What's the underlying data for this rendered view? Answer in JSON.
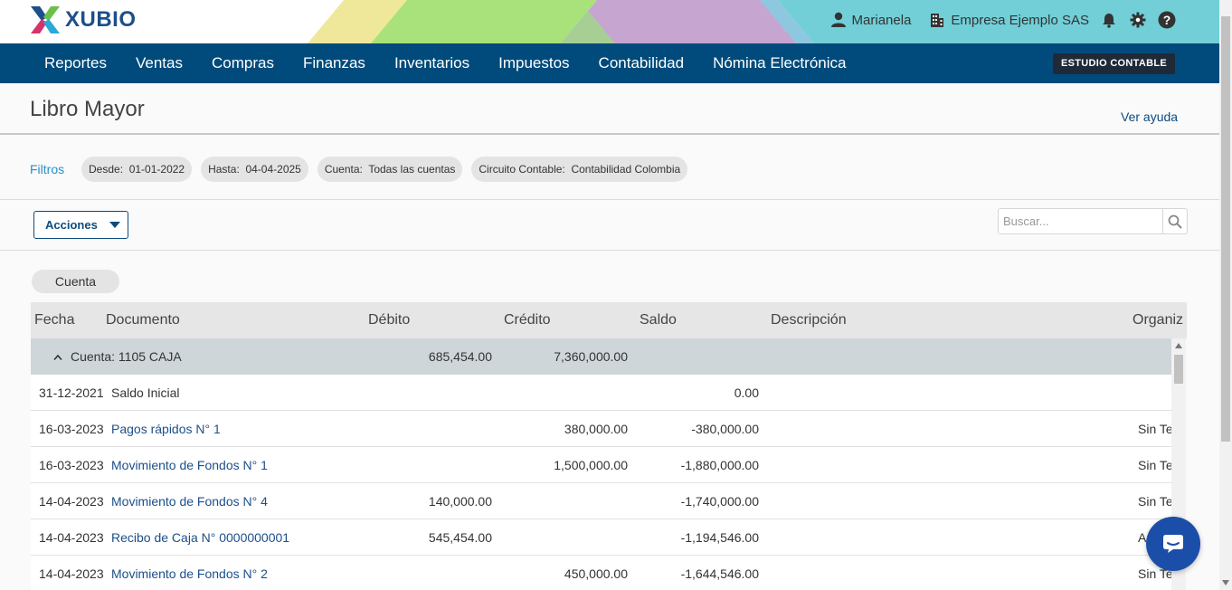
{
  "brand": {
    "name": "XUBIO"
  },
  "user": {
    "name": "Marianela",
    "company": "Empresa Ejemplo SAS"
  },
  "nav": {
    "items": [
      "Reportes",
      "Ventas",
      "Compras",
      "Finanzas",
      "Inventarios",
      "Impuestos",
      "Contabilidad",
      "Nómina Electrónica"
    ],
    "studio_label": "ESTUDIO CONTABLE"
  },
  "page": {
    "title": "Libro Mayor",
    "help_link": "Ver ayuda"
  },
  "filters": {
    "label": "Filtros",
    "chips": [
      {
        "name": "Desde:",
        "value": "01-01-2022"
      },
      {
        "name": "Hasta:",
        "value": "04-04-2025"
      },
      {
        "name": "Cuenta:",
        "value": "Todas las cuentas"
      },
      {
        "name": "Circuito Contable:",
        "value": "Contabilidad Colombia"
      }
    ]
  },
  "actions": {
    "label": "Acciones"
  },
  "search": {
    "placeholder": "Buscar..."
  },
  "grouping": {
    "chip_label": "Cuenta"
  },
  "table": {
    "columns": [
      "Fecha",
      "Documento",
      "Débito",
      "Crédito",
      "Saldo",
      "Descripción",
      "Organiz"
    ],
    "group": {
      "label": "Cuenta: 1105 CAJA",
      "debito": "685,454.00",
      "credito": "7,360,000.00"
    },
    "rows": [
      {
        "fecha": "31-12-2021",
        "documento": "Saldo Inicial",
        "debito": "",
        "credito": "",
        "saldo": "0.00",
        "descripcion": "",
        "organizacion": ""
      },
      {
        "fecha": "16-03-2023",
        "documento": "Pagos rápidos N° 1",
        "debito": "",
        "credito": "380,000.00",
        "saldo": "-380,000.00",
        "descripcion": "",
        "organizacion": "Sin Te"
      },
      {
        "fecha": "16-03-2023",
        "documento": "Movimiento de Fondos N° 1",
        "debito": "",
        "credito": "1,500,000.00",
        "saldo": "-1,880,000.00",
        "descripcion": "",
        "organizacion": "Sin Te"
      },
      {
        "fecha": "14-04-2023",
        "documento": "Movimiento de Fondos N° 4",
        "debito": "140,000.00",
        "credito": "",
        "saldo": "-1,740,000.00",
        "descripcion": "",
        "organizacion": "Sin Te"
      },
      {
        "fecha": "14-04-2023",
        "documento": "Recibo de Caja N° 0000000001",
        "debito": "545,454.00",
        "credito": "",
        "saldo": "-1,194,546.00",
        "descripcion": "",
        "organizacion": "A"
      },
      {
        "fecha": "14-04-2023",
        "documento": "Movimiento de Fondos N° 2",
        "debito": "",
        "credito": "450,000.00",
        "saldo": "-1,644,546.00",
        "descripcion": "",
        "organizacion": "Sin Te"
      }
    ]
  },
  "colors": {
    "nav_bg": "#004b7c",
    "link": "#1d4f8a",
    "filters_label": "#2a8fc7",
    "chat": "#1b4ea8"
  }
}
